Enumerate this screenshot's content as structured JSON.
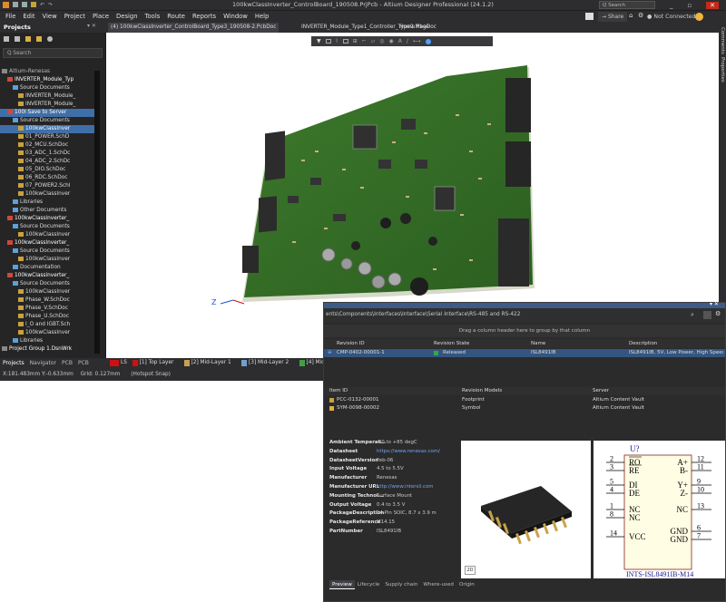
{
  "titlebar": {
    "title": "100kwClassInverter_ControlBoard_190508.PrjPcb - Altium Designer Professional (24.1.2)",
    "search_placeholder": "Q Search",
    "share_label": "Share",
    "not_connected_label": "Not Connected"
  },
  "menubar": [
    "File",
    "Edit",
    "View",
    "Project",
    "Place",
    "Design",
    "Tools",
    "Route",
    "Reports",
    "Window",
    "Help"
  ],
  "projects_panel": {
    "title": "Projects",
    "search_placeholder": "Q Search",
    "tree": [
      {
        "label": "Altium-Renesas",
        "indent": 0,
        "color": "#bbb"
      },
      {
        "label": "INVERTER_Module_Typ",
        "indent": 1,
        "color": "#fff"
      },
      {
        "label": "Source Documents",
        "indent": 2,
        "color": "#ddd"
      },
      {
        "label": "INVERTER_Module_",
        "indent": 3,
        "color": "#ddd"
      },
      {
        "label": "INVERTER_Module_",
        "indent": 3,
        "color": "#ddd"
      },
      {
        "label": "100l Save to Server",
        "indent": 1,
        "color": "#fff",
        "selected": true
      },
      {
        "label": "Source Documents",
        "indent": 2,
        "color": "#ddd"
      },
      {
        "label": "100kwClassInver",
        "indent": 3,
        "color": "#fff",
        "selected": true
      },
      {
        "label": "01_POWER.SchD",
        "indent": 3,
        "color": "#ddd"
      },
      {
        "label": "02_MCU.SchDoc",
        "indent": 3,
        "color": "#ddd"
      },
      {
        "label": "03_ADC_1.SchDc",
        "indent": 3,
        "color": "#ddd"
      },
      {
        "label": "04_ADC_2.SchDc",
        "indent": 3,
        "color": "#ddd"
      },
      {
        "label": "05_DIO.SchDoc",
        "indent": 3,
        "color": "#ddd"
      },
      {
        "label": "06_RDC.SchDoc",
        "indent": 3,
        "color": "#ddd"
      },
      {
        "label": "07_POWER2.Schl",
        "indent": 3,
        "color": "#ddd"
      },
      {
        "label": "100kwClassInver",
        "indent": 3,
        "color": "#ddd"
      },
      {
        "label": "Libraries",
        "indent": 2,
        "color": "#ddd"
      },
      {
        "label": "Other Documents",
        "indent": 2,
        "color": "#ddd"
      },
      {
        "label": "100kwClassInverter_",
        "indent": 1,
        "color": "#fff"
      },
      {
        "label": "Source Documents",
        "indent": 2,
        "color": "#ddd"
      },
      {
        "label": "100kwClassInver",
        "indent": 3,
        "color": "#ddd"
      },
      {
        "label": "100kwClassInverter_",
        "indent": 1,
        "color": "#fff"
      },
      {
        "label": "Source Documents",
        "indent": 2,
        "color": "#ddd"
      },
      {
        "label": "100kwClassInver",
        "indent": 3,
        "color": "#ddd"
      },
      {
        "label": "Documentation",
        "indent": 2,
        "color": "#ddd"
      },
      {
        "label": "100kwClassInverter_",
        "indent": 1,
        "color": "#fff"
      },
      {
        "label": "Source Documents",
        "indent": 2,
        "color": "#ddd"
      },
      {
        "label": "100kwClassInver",
        "indent": 3,
        "color": "#ddd"
      },
      {
        "label": "Phase_W.SchDoc",
        "indent": 3,
        "color": "#ddd"
      },
      {
        "label": "Phase_V.SchDoc",
        "indent": 3,
        "color": "#ddd"
      },
      {
        "label": "Phase_U.SchDoc",
        "indent": 3,
        "color": "#ddd"
      },
      {
        "label": "I_O and IGBT.Sch",
        "indent": 3,
        "color": "#ddd"
      },
      {
        "label": "100kwClassInver",
        "indent": 3,
        "color": "#ddd"
      },
      {
        "label": "Libraries",
        "indent": 2,
        "color": "#ddd"
      },
      {
        "label": "Project Group 1.DsnWrk",
        "indent": 0,
        "color": "#fff"
      }
    ],
    "bottom_tabs": [
      "Projects",
      "Navigator",
      "PCB",
      "PCB Filter"
    ]
  },
  "doc_tabs": [
    {
      "label": "(4) 100kwClassInverter_ControlBoard_Type3_190508-2.PcbDoc",
      "active": true
    },
    {
      "label": "INVERTER_Module_Type1_Controller_Type2.MbaDoc",
      "active": false
    },
    {
      "label": "Home Page",
      "active": false
    }
  ],
  "layers": [
    {
      "label": "LS",
      "color": "#d01010"
    },
    {
      "label": "[1] Top Layer",
      "color": "#d01010"
    },
    {
      "label": "[2] Mid-Layer 1",
      "color": "#c8a050"
    },
    {
      "label": "[3] Mid-Layer 2",
      "color": "#70a0d0"
    },
    {
      "label": "[4] Mid-Layer",
      "color": "#40a040"
    }
  ],
  "status": {
    "coords": "X:181.483mm Y:-0.633mm",
    "grid": "Grid: 0.127mm",
    "snap": "(Hotspot Snap)"
  },
  "right_dock": [
    "Comments",
    "Properties"
  ],
  "explorer": {
    "path": "ents\\Components\\Interfaces\\Interface\\Serial Interface\\RS-485 and RS-422",
    "group_hint": "Drag a column header here to group by that column",
    "columns": [
      "Revision ID",
      "Revision State",
      "Name",
      "Description"
    ],
    "rows": [
      {
        "revision_id": "CMP-0402-00001-1",
        "state": "Released",
        "name": "ISL8491IB",
        "description": "ISL8491IB, 5V, Low Power, High Speed..."
      }
    ],
    "models_columns": [
      "Item ID",
      "Revision Models",
      "Server"
    ],
    "models": [
      {
        "item_id": "PCC-0132-00001",
        "model": "Footprint",
        "server": "Altium Content Vault"
      },
      {
        "item_id": "SYM-0098-00002",
        "model": "Symbol",
        "server": "Altium Content Vault"
      }
    ],
    "properties": [
      {
        "k": "Ambient Temperat...",
        "v": "-40 to +85 degC"
      },
      {
        "k": "Datasheet",
        "v": "https://www.renesas.com/",
        "link": true
      },
      {
        "k": "DatasheetVersion",
        "v": "Feb-06"
      },
      {
        "k": "Input Voltage",
        "v": "4.5 to 5.5V"
      },
      {
        "k": "Manufacturer",
        "v": "Renesas"
      },
      {
        "k": "Manufacturer URL",
        "v": "http://www.intersil.com",
        "link": true
      },
      {
        "k": "Mounting Technol...",
        "v": "Surface Mount"
      },
      {
        "k": "Output Voltage",
        "v": "0.4 to 3.5 V"
      },
      {
        "k": "PackageDescription",
        "v": "14-Pin SOIC, 8.7 x 3.9 m"
      },
      {
        "k": "PackageReference",
        "v": "M14.15"
      },
      {
        "k": "PartNumber",
        "v": "ISL8491IB"
      }
    ],
    "preview_2d_label": "2D",
    "symbol": {
      "designator": "U?",
      "left_pins": [
        {
          "num": "2",
          "name": "RO",
          "bar": true
        },
        {
          "num": "3",
          "name": "RE",
          "bar": true
        },
        {
          "num": "5",
          "name": "DI"
        },
        {
          "num": "4",
          "name": "DE"
        },
        {
          "num": "1",
          "name": "NC"
        },
        {
          "num": "8",
          "name": "NC"
        },
        {
          "num": "14",
          "name": "VCC"
        }
      ],
      "right_pins": [
        {
          "num": "12",
          "name": "A+"
        },
        {
          "num": "11",
          "name": "B-"
        },
        {
          "num": "9",
          "name": "Y+"
        },
        {
          "num": "10",
          "name": "Z-"
        },
        {
          "num": "13",
          "name": "NC"
        },
        {
          "num": "6",
          "name": "GND"
        },
        {
          "num": "7",
          "name": "GND"
        }
      ],
      "footer": "INTS-ISL8491IB-M14"
    },
    "bottom_tabs": [
      "Preview",
      "Lifecycle",
      "Supply chain",
      "Where-used",
      "Origin"
    ]
  }
}
